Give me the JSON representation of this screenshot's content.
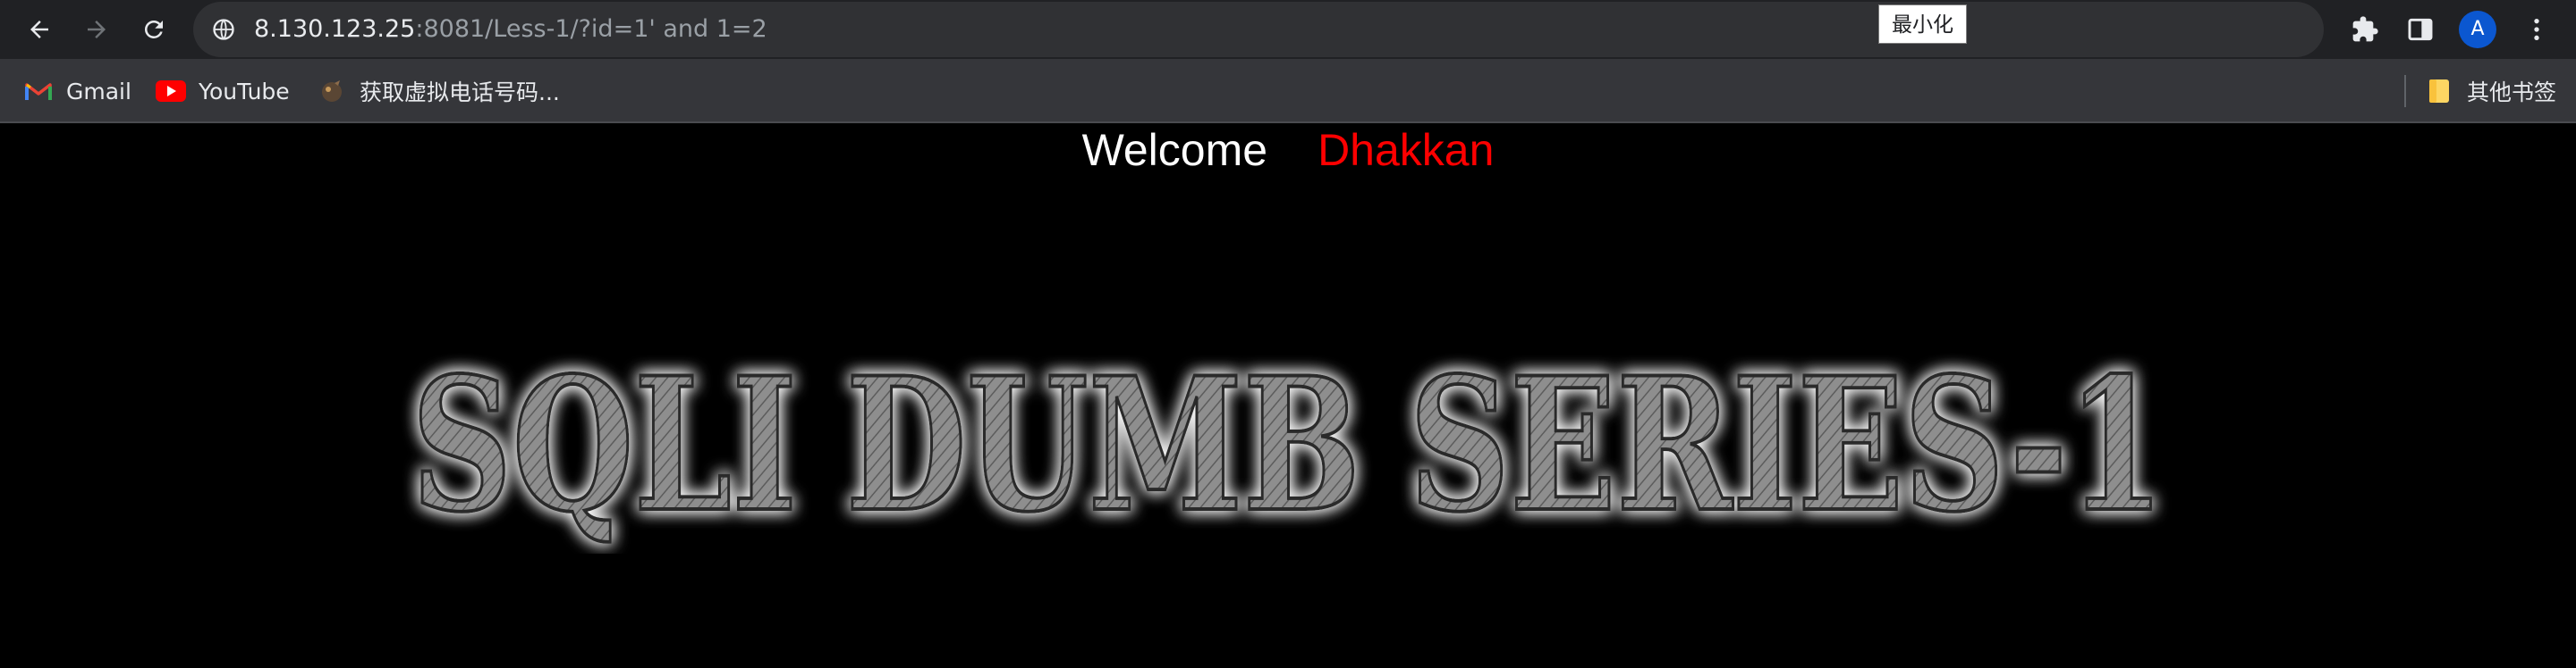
{
  "browser": {
    "url_host": "8.130.123.25",
    "url_rest": ":8081/Less-1/?id=1' and 1=2",
    "tooltip": "最小化",
    "profile_initial": "A",
    "icons": {
      "back": "arrow-left-icon",
      "forward": "arrow-right-icon",
      "reload": "reload-icon",
      "site_info": "site-info-icon",
      "extensions": "puzzle-icon",
      "side_panel": "side-panel-icon",
      "menu": "kebab-menu-icon"
    }
  },
  "bookmarks": {
    "items": [
      {
        "label": "Gmail",
        "icon": "gmail-icon"
      },
      {
        "label": "YouTube",
        "icon": "youtube-icon"
      },
      {
        "label": "获取虚拟电话号码...",
        "icon": "site-favicon-icon"
      }
    ],
    "other": {
      "label": "其他书签",
      "icon": "folder-icon"
    }
  },
  "page": {
    "welcome_text": "Welcome",
    "welcome_name": "Dhakkan",
    "logo_text": "SQLI DUMB SERIES-1",
    "colors": {
      "background": "#000000",
      "welcome": "#ffffff",
      "name": "#ff0000"
    }
  }
}
